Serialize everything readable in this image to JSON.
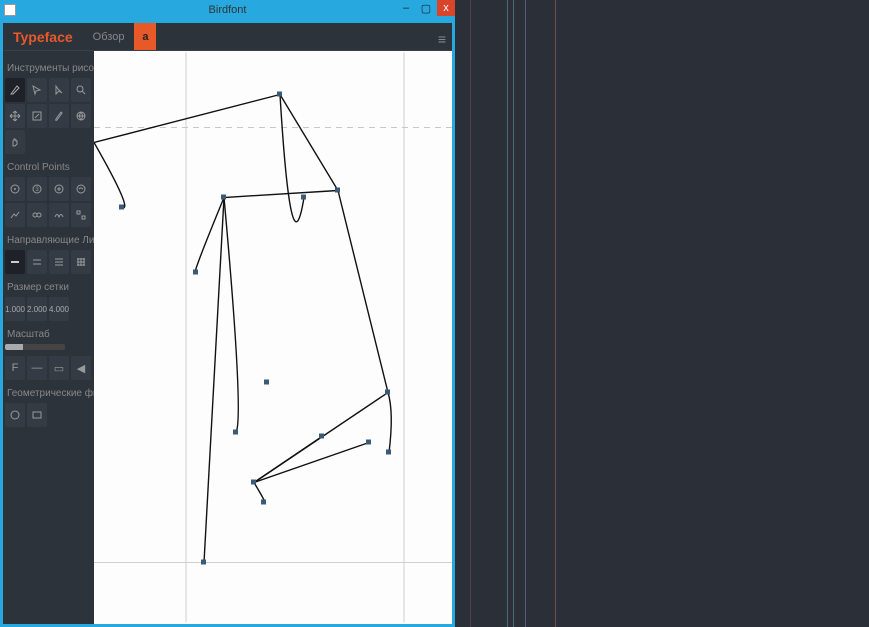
{
  "window": {
    "title": "Birdfont",
    "min": "–",
    "max": "▢",
    "close": "x"
  },
  "app": {
    "logo": "Typeface",
    "tabs": {
      "overview": "Обзор",
      "glyph": "a"
    },
    "hamburger": "≡"
  },
  "sidebar": {
    "sections": {
      "drawing": "Инструменты рисования",
      "control_points": "Control Points",
      "guides": "Направляющие Линии и С",
      "grid_size": "Размер сетки",
      "scale": "Масштаб",
      "shapes": "Геометрические фигуры"
    },
    "grid_values": [
      "1.000",
      "2.000",
      "4.000"
    ],
    "scale_buttons": {
      "f": "F",
      "dash": "—",
      "bar": "▭",
      "tri": "◀"
    }
  }
}
